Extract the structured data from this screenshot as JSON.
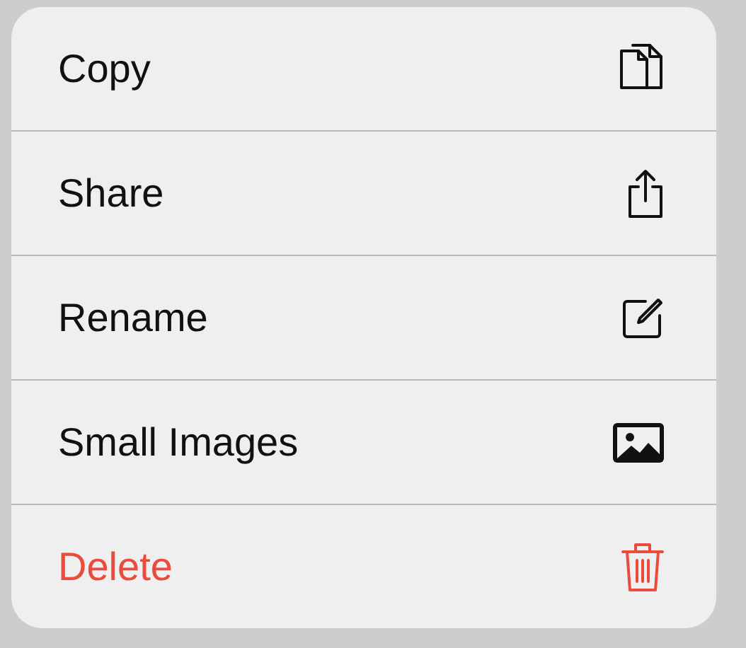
{
  "menu": {
    "items": [
      {
        "label": "Copy",
        "kind": "normal"
      },
      {
        "label": "Share",
        "kind": "normal"
      },
      {
        "label": "Rename",
        "kind": "normal"
      },
      {
        "label": "Small Images",
        "kind": "normal"
      },
      {
        "label": "Delete",
        "kind": "destructive"
      }
    ]
  }
}
